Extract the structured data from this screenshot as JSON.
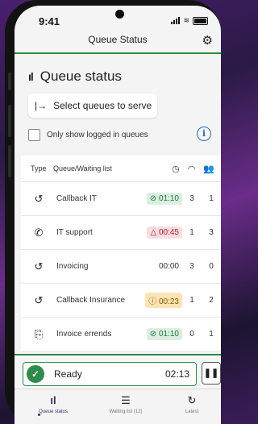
{
  "status_bar": {
    "time": "9:41"
  },
  "header": {
    "title": "Queue Status"
  },
  "section": {
    "title": "Queue status"
  },
  "select_button": {
    "label": "Select queues to serve"
  },
  "filter": {
    "label": "Only show logged in queues"
  },
  "list": {
    "columns": {
      "type": "Type",
      "name": "Queue/Waiting list"
    },
    "rows": [
      {
        "icon": "callback-icon",
        "glyph": "↺",
        "name": "Callback IT",
        "time": "01:10",
        "time_prefix": "⊘",
        "status": "green",
        "a": "3",
        "b": "1"
      },
      {
        "icon": "phone-icon",
        "glyph": "✆",
        "name": "IT support",
        "time": "00:45",
        "time_prefix": "△",
        "status": "red",
        "a": "1",
        "b": "3"
      },
      {
        "icon": "callback-icon",
        "glyph": "↺",
        "name": "Invoicing",
        "time": "00:00",
        "time_prefix": "",
        "status": "plain",
        "a": "3",
        "b": "0"
      },
      {
        "icon": "callback-icon",
        "glyph": "↺",
        "name": "Callback Insurance",
        "time": "00:23",
        "time_prefix": "ⓘ",
        "status": "amber",
        "a": "1",
        "b": "2"
      },
      {
        "icon": "errand-icon",
        "glyph": "⎘",
        "name": "Invoice errends",
        "time": "01:10",
        "time_prefix": "⊘",
        "status": "green",
        "a": "0",
        "b": "1"
      }
    ]
  },
  "agent_status": {
    "label": "Ready",
    "time": "02:13"
  },
  "tabs": [
    {
      "label": "Queue status",
      "icon": "bars-icon",
      "glyph": "ıl"
    },
    {
      "label": "Waiting list (12)",
      "icon": "list-icon",
      "glyph": "☰"
    },
    {
      "label": "Latest",
      "icon": "history-icon",
      "glyph": "↻"
    }
  ],
  "colors": {
    "accent": "#2e8b4a",
    "tab_active": "#3a2a5e"
  }
}
